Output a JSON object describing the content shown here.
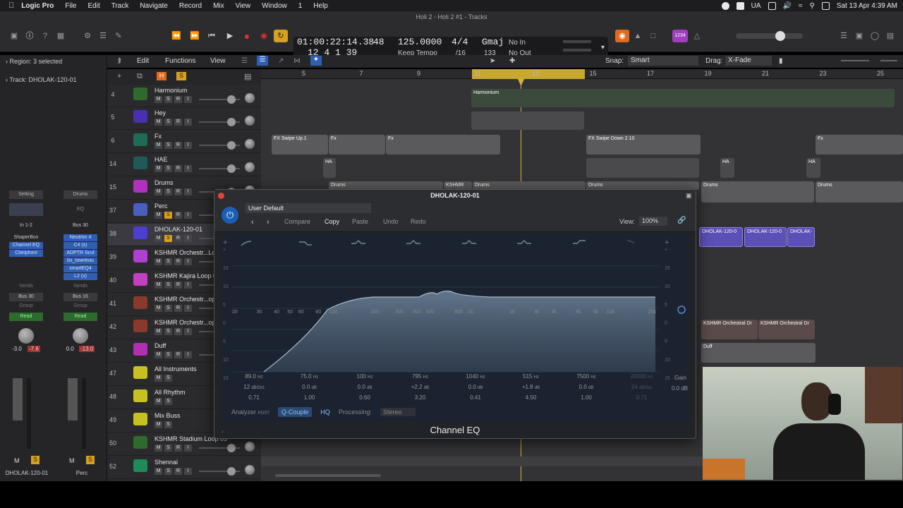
{
  "menubar": {
    "app_name": "Logic Pro",
    "items": [
      "File",
      "Edit",
      "Track",
      "Navigate",
      "Record",
      "Mix",
      "View",
      "Window",
      "1",
      "Help"
    ],
    "locale": "UA",
    "datetime": "Sat 13 Apr  4:39 AM"
  },
  "window": {
    "title": "Holi 2 - Holi 2 #1 - Tracks"
  },
  "lcd": {
    "timecode": "01:00:22:14.38",
    "position": "12  4  1    39",
    "beats_label": "48",
    "beats_sub": "133",
    "tempo": "125.0000",
    "tempo_mode": "Keep Tempo",
    "signature": "4/4",
    "division": "/16",
    "key": "Gmaj",
    "in": "No In",
    "out": "No Out"
  },
  "badges": {
    "count_in": "1234"
  },
  "inspector": {
    "region_label": "Region:",
    "region_value": "3 selected",
    "track_label": "Track:",
    "track_value": "DHOLAK-120-01",
    "strip1": {
      "setting": "Setting",
      "io": "In 1-2",
      "plugins": [
        "ShaperBox",
        "Channel EQ",
        "Clariphoni"
      ],
      "sends": "Sends",
      "bus": "Bus 30",
      "group": "Group",
      "auto": "Read",
      "vol": "-3.0",
      "peak": "-7.6",
      "name": "DHOLAK-120-01"
    },
    "strip2": {
      "setting": "Drums",
      "eq": "EQ",
      "io": "Bus 30",
      "plugins": [
        "Neutron 4",
        "C4 (s)",
        "ADPTR Scul",
        "bx_townhou",
        "smartEQ4",
        "L2 (s)"
      ],
      "sends": "Sends",
      "bus": "Bus 16",
      "group": "Group",
      "auto": "Read",
      "vol": "0.0",
      "peak": "-13.0",
      "name": "Perc"
    }
  },
  "toolbar": {
    "edit": "Edit",
    "functions": "Functions",
    "view": "View",
    "snap_label": "Snap:",
    "snap_value": "Smart",
    "drag_label": "Drag:",
    "drag_value": "X-Fade"
  },
  "tracks": [
    {
      "num": "4",
      "name": "Harmonium",
      "color": "#2e6a2e",
      "btns": [
        "M",
        "S",
        "R",
        "I"
      ]
    },
    {
      "num": "5",
      "name": "Hey",
      "color": "#4a2fb0",
      "btns": [
        "M",
        "S",
        "R",
        "I"
      ]
    },
    {
      "num": "6",
      "name": "Fx",
      "color": "#1f6b5a",
      "btns": [
        "M",
        "S",
        "R",
        "I"
      ]
    },
    {
      "num": "14",
      "name": "HAE",
      "color": "#1f5a5a",
      "btns": [
        "M",
        "S",
        "R",
        "I"
      ]
    },
    {
      "num": "15",
      "name": "Drums",
      "color": "#b030c0",
      "btns": [
        "M",
        "S",
        "R",
        "I"
      ]
    },
    {
      "num": "37",
      "name": "Perc",
      "color": "#4a5ec0",
      "btns": [
        "M",
        "S",
        "R",
        "I"
      ]
    },
    {
      "num": "38",
      "name": "DHOLAK-120-01",
      "color": "#4a3fd0",
      "btns": [
        "M",
        "S",
        "R",
        "I"
      ]
    },
    {
      "num": "39",
      "name": "KSHMR Orchestr...Lo",
      "color": "#b040d0",
      "btns": [
        "M",
        "S",
        "R",
        "I"
      ]
    },
    {
      "num": "40",
      "name": "KSHMR Kajira Loop 0",
      "color": "#c040c0",
      "btns": [
        "M",
        "S",
        "R",
        "I"
      ]
    },
    {
      "num": "41",
      "name": "KSHMR Orchestr...op",
      "color": "#8a3a2a",
      "btns": [
        "M",
        "S",
        "R",
        "I"
      ]
    },
    {
      "num": "42",
      "name": "KSHMR Orchestr...op",
      "color": "#8a3a2a",
      "btns": [
        "M",
        "S",
        "R",
        "I"
      ]
    },
    {
      "num": "43",
      "name": "Duff",
      "color": "#b030b0",
      "btns": [
        "M",
        "S",
        "R",
        "I"
      ]
    },
    {
      "num": "47",
      "name": "All Instruments",
      "color": "#c8c020",
      "btns": [
        "M",
        "S"
      ]
    },
    {
      "num": "48",
      "name": "All Rhythm",
      "color": "#c8c020",
      "btns": [
        "M",
        "S"
      ]
    },
    {
      "num": "49",
      "name": "Mix Buss",
      "color": "#c8c020",
      "btns": [
        "M",
        "S"
      ]
    },
    {
      "num": "50",
      "name": "KSHMR Stadium Loop 05",
      "color": "#2e6a2e",
      "btns": [
        "M",
        "S",
        "R",
        "I"
      ]
    },
    {
      "num": "52",
      "name": "Shennai",
      "color": "#1f8a5a",
      "btns": [
        "M",
        "S",
        "R",
        "I"
      ]
    }
  ],
  "ruler_bars": [
    "5",
    "7",
    "9",
    "11",
    "13",
    "15",
    "17",
    "19",
    "21",
    "23",
    "25"
  ],
  "regions": {
    "harmonium": "Harmonium",
    "fx1": "FX Swipe Up.1",
    "fx2": "Fx",
    "fx3": "Fx",
    "fx4": "FX Swipe Down 2.10",
    "fx5": "Fx",
    "hae1": "HA",
    "hae2": "HA",
    "hae3": "HA",
    "drums1": "Drums",
    "drums2": "KSHMR",
    "drums3": "Drums",
    "drums4": "Drums",
    "drums5": "Drums",
    "drums6": "Drums",
    "dholak1": "DHOLAK-120-0",
    "dholak2": "DHOLAK-120-0",
    "dholak3": "DHOLAK-",
    "orch1": "KSHMR Orchestral Dr",
    "orch2": "KSHMR Orchestral Dr",
    "duff": "Duff"
  },
  "plugin": {
    "title": "DHOLAK-120-01",
    "preset": "User Default",
    "compare": "Compare",
    "copy": "Copy",
    "paste": "Paste",
    "undo": "Undo",
    "redo": "Redo",
    "view_label": "View:",
    "view_value": "100%",
    "name": "Channel EQ",
    "analyzer": "Analyzer",
    "analyzer_sub": "POST",
    "qcouple": "Q-Couple",
    "hq": "HQ",
    "processing_label": "Processing:",
    "processing_value": "Stereo",
    "gain_label": "Gain",
    "gain_value": "0.0 dB",
    "freq_labels": [
      "20",
      "30",
      "40",
      "50",
      "60",
      "80",
      "100",
      "200",
      "300",
      "400",
      "500",
      "800",
      "1k",
      "2k",
      "3k",
      "4k",
      "6k",
      "8k",
      "10k",
      "20k"
    ],
    "db_labels_left": [
      "+",
      "15",
      "10",
      "5",
      "0",
      "5",
      "10",
      "15"
    ],
    "bands": [
      {
        "freq": "89.0",
        "fu": "Hz",
        "gain": "12",
        "gu": "dB/Oct",
        "q": "0.71"
      },
      {
        "freq": "75.0",
        "fu": "Hz",
        "gain": "0.0",
        "gu": "dB",
        "q": "1.00"
      },
      {
        "freq": "100",
        "fu": "Hz",
        "gain": "0.0",
        "gu": "dB",
        "q": "0.60"
      },
      {
        "freq": "795",
        "fu": "Hz",
        "gain": "+2.2",
        "gu": "dB",
        "q": "3.20"
      },
      {
        "freq": "1040",
        "fu": "Hz",
        "gain": "0.0",
        "gu": "dB",
        "q": "0.41"
      },
      {
        "freq": "515",
        "fu": "Hz",
        "gain": "+1.8",
        "gu": "dB",
        "q": "4.50"
      },
      {
        "freq": "7500",
        "fu": "Hz",
        "gain": "0.0",
        "gu": "dB",
        "q": "1.00"
      },
      {
        "freq": "20000",
        "fu": "Hz",
        "gain": "24",
        "gu": "dB/Oct",
        "q": "0.71"
      }
    ]
  }
}
